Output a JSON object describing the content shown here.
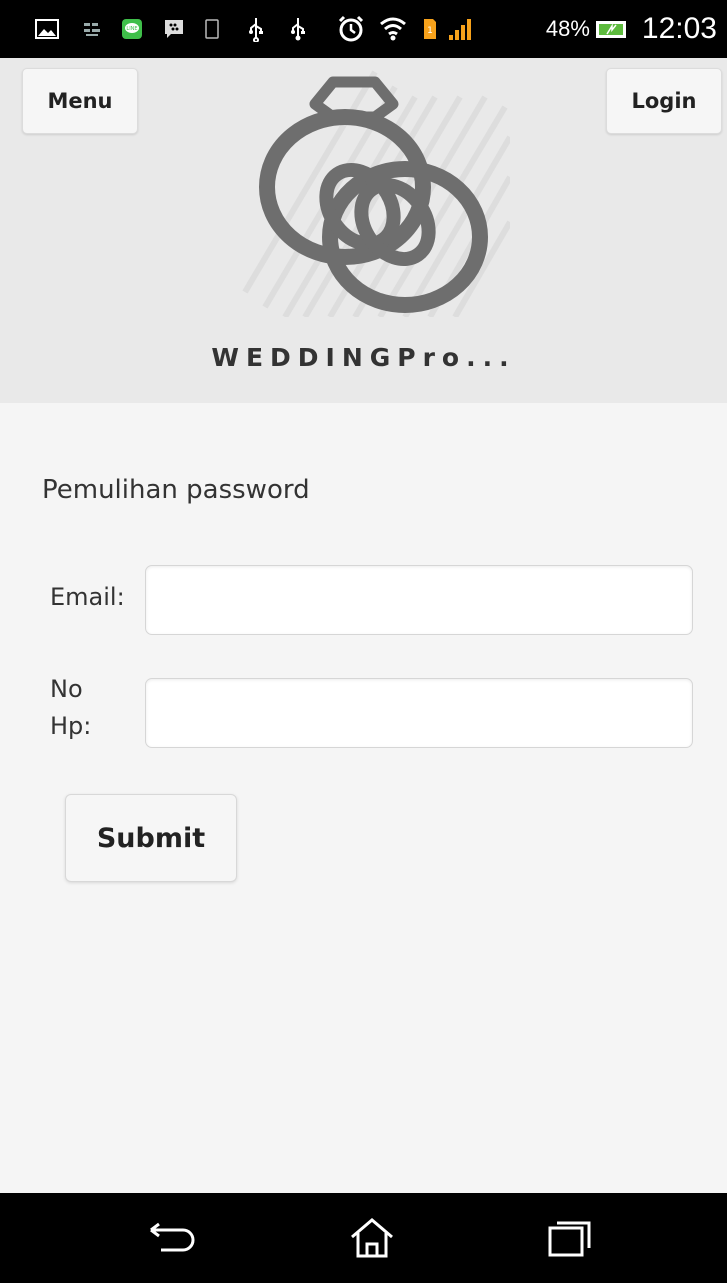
{
  "status_bar": {
    "icons": [
      "gallery-icon",
      "app-notification-icon",
      "line-icon",
      "bbm-icon",
      "phone-notification-icon",
      "usb-icon",
      "usb-debug-icon",
      "alarm-icon",
      "wifi-icon",
      "sim-icon",
      "signal-icon",
      "battery-icon"
    ],
    "battery_percent": "48%",
    "time": "12:03"
  },
  "header": {
    "menu_label": "Menu",
    "login_label": "Login",
    "logo_icon": "wedding-rings-icon",
    "brand_text": "WEDDINGPro..."
  },
  "form": {
    "heading": "Pemulihan password",
    "email_label": "Email:",
    "email_value": "",
    "hp_label": "No Hp:",
    "hp_value": "",
    "submit_label": "Submit"
  },
  "nav_bar": {
    "icons": [
      "back-icon",
      "home-icon",
      "recent-apps-icon"
    ]
  }
}
